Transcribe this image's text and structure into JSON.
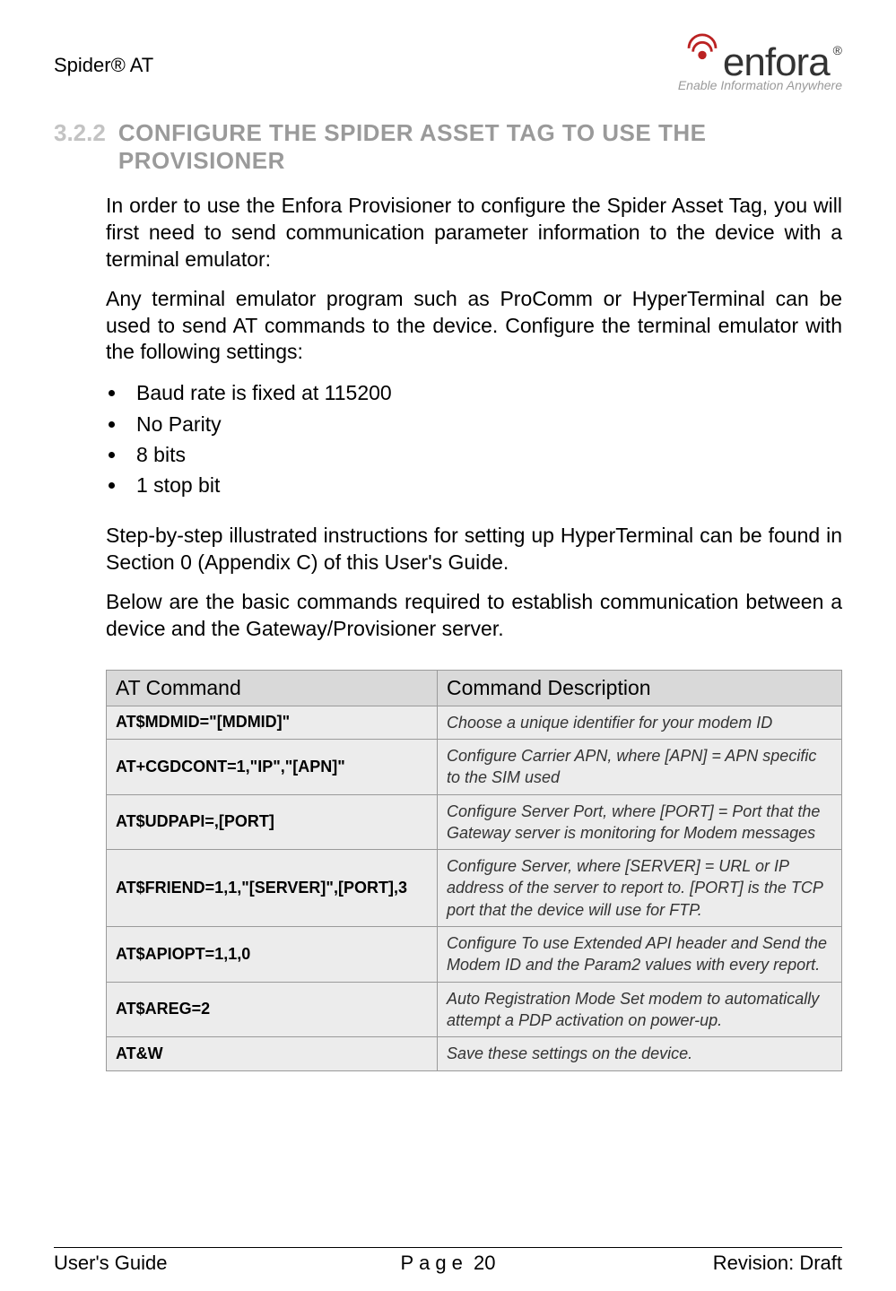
{
  "header": {
    "product_name": "Spider® AT",
    "logo_text": "enfora",
    "logo_tagline": "Enable Information Anywhere"
  },
  "section": {
    "number": "3.2.2",
    "title": "CONFIGURE THE SPIDER ASSET TAG TO USE THE PROVISIONER"
  },
  "paragraphs": {
    "p1": "In order to use the Enfora Provisioner to configure the Spider Asset Tag, you will first need to send communication parameter information to the device with a terminal emulator:",
    "p2": "Any terminal emulator program such as ProComm or HyperTerminal can be used to send AT commands to the device. Configure the terminal emulator with the following settings:",
    "p3": "Step-by-step illustrated instructions for setting up HyperTerminal can be found in Section 0 (Appendix C) of this User's Guide.",
    "p4": "Below are the basic commands required to establish communication between a device and the Gateway/Provisioner server."
  },
  "bullets": [
    "Baud rate is fixed at 115200",
    "No Parity",
    "8 bits",
    "1 stop bit"
  ],
  "table": {
    "header_cmd": "AT Command",
    "header_desc": "Command Description",
    "rows": [
      {
        "cmd": "AT$MDMID=\"[MDMID]\"",
        "desc": "Choose a unique identifier for your modem ID"
      },
      {
        "cmd": "AT+CGDCONT=1,\"IP\",\"[APN]\"",
        "desc": "Configure Carrier APN, where [APN] = APN specific to the SIM used"
      },
      {
        "cmd": "AT$UDPAPI=,[PORT]",
        "desc": "Configure Server Port, where [PORT] = Port that the Gateway server is monitoring for Modem messages"
      },
      {
        "cmd": "AT$FRIEND=1,1,\"[SERVER]\",[PORT],3",
        "desc": "Configure Server, where [SERVER] = URL or IP address of the server to report to. [PORT] is the TCP port that the device will use for FTP."
      },
      {
        "cmd": "AT$APIOPT=1,1,0",
        "desc": "Configure To use Extended API header and Send the Modem ID and the Param2 values with every report."
      },
      {
        "cmd": "AT$AREG=2",
        "desc": "Auto Registration Mode Set modem to automatically attempt a PDP activation on power-up."
      },
      {
        "cmd": "AT&W",
        "desc": "Save these settings on the device."
      }
    ]
  },
  "footer": {
    "left": "User's Guide",
    "page_label": "Page",
    "page_number": "20",
    "right": "Revision: Draft"
  }
}
